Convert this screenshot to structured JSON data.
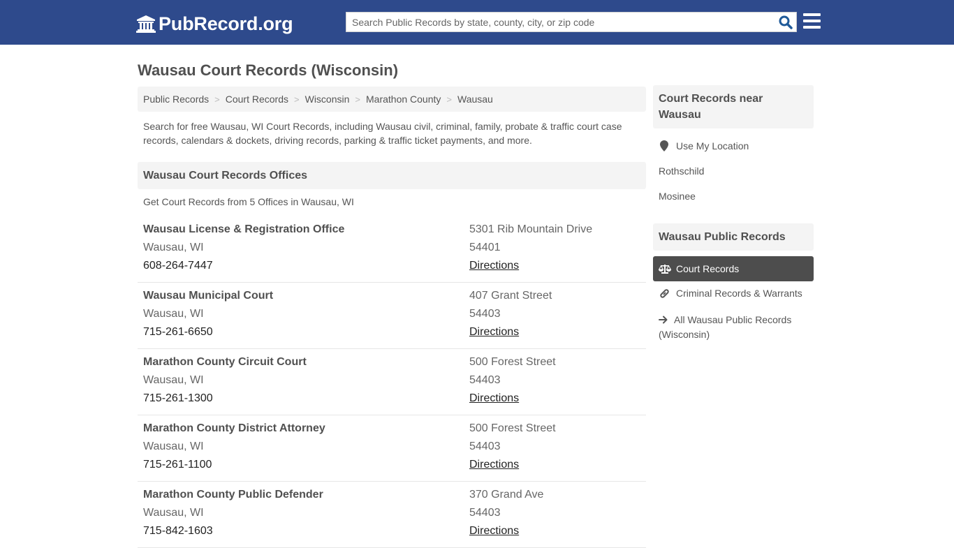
{
  "header": {
    "logo_text": "PubRecord.org",
    "logo_icon": "courthouse-icon",
    "search_placeholder": "Search Public Records by state, county, city, or zip code",
    "search_value": "",
    "search_icon": "search-icon",
    "menu_icon": "hamburger-menu-icon",
    "background_color": "#2e4a8c"
  },
  "page": {
    "title": "Wausau Court Records (Wisconsin)",
    "breadcrumb": [
      {
        "label": "Public Records"
      },
      {
        "label": "Court Records"
      },
      {
        "label": "Wisconsin"
      },
      {
        "label": "Marathon County"
      },
      {
        "label": "Wausau"
      }
    ],
    "breadcrumb_separator": ">",
    "intro": "Search for free Wausau, WI Court Records, including Wausau civil, criminal, family, probate & traffic court case records, calendars & dockets, driving records, parking & traffic ticket payments, and more."
  },
  "offices_section": {
    "heading": "Wausau Court Records Offices",
    "subheading": "Get Court Records from 5 Offices in Wausau, WI",
    "offices": [
      {
        "name": "Wausau License & Registration Office",
        "city": "Wausau, WI",
        "phone": "608-264-7447",
        "address": "5301 Rib Mountain Drive",
        "zip": "54401",
        "directions": "Directions"
      },
      {
        "name": "Wausau Municipal Court",
        "city": "Wausau, WI",
        "phone": "715-261-6650",
        "address": "407 Grant Street",
        "zip": "54403",
        "directions": "Directions"
      },
      {
        "name": "Marathon County Circuit Court",
        "city": "Wausau, WI",
        "phone": "715-261-1300",
        "address": "500 Forest Street",
        "zip": "54403",
        "directions": "Directions"
      },
      {
        "name": "Marathon County District Attorney",
        "city": "Wausau, WI",
        "phone": "715-261-1100",
        "address": "500 Forest Street",
        "zip": "54403",
        "directions": "Directions"
      },
      {
        "name": "Marathon County Public Defender",
        "city": "Wausau, WI",
        "phone": "715-842-1603",
        "address": "370 Grand Ave",
        "zip": "54403",
        "directions": "Directions"
      }
    ]
  },
  "sidebar": {
    "near_heading": "Court Records near Wausau",
    "use_location": {
      "label": "Use My Location",
      "icon": "map-marker-icon"
    },
    "nearby": [
      {
        "label": "Rothschild"
      },
      {
        "label": "Mosinee"
      }
    ],
    "public_heading": "Wausau Public Records",
    "public_links": [
      {
        "label": "Court Records",
        "icon": "balance-scale-icon",
        "active": true
      },
      {
        "label": "Criminal Records & Warrants",
        "icon": "link-icon",
        "active": false
      },
      {
        "label": "All Wausau Public Records (Wisconsin)",
        "icon": "arrow-right-icon",
        "active": false
      }
    ]
  }
}
